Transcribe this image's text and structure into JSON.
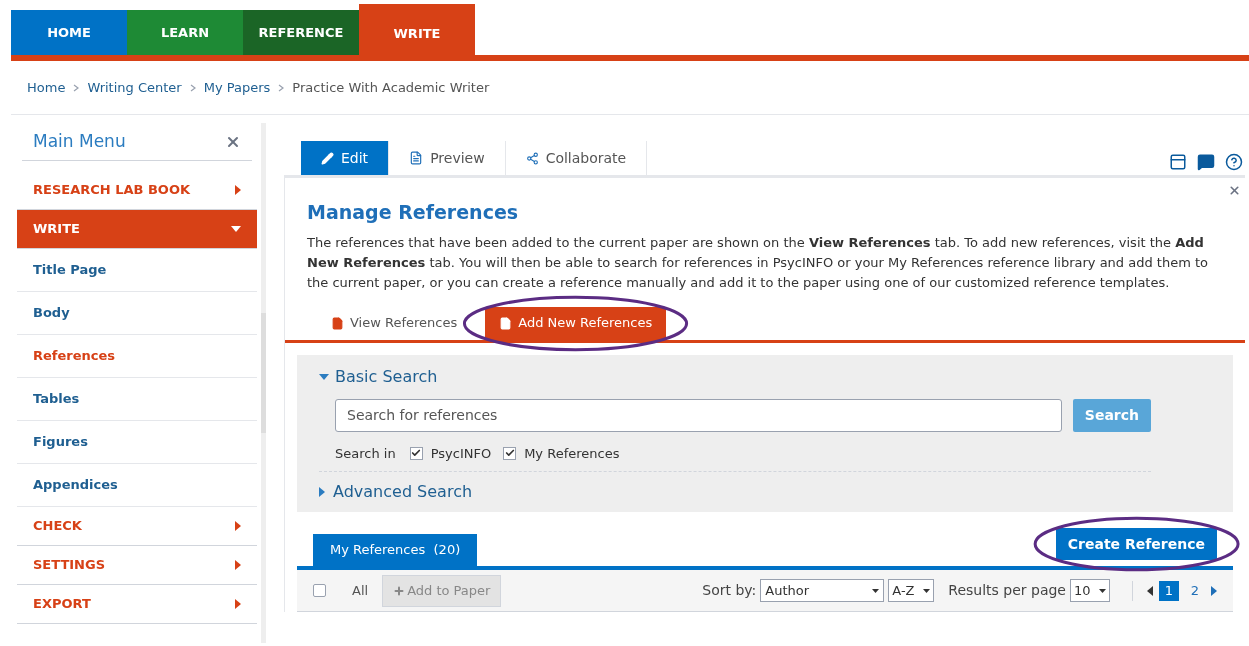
{
  "nav": {
    "tabs": [
      {
        "label": "HOME",
        "color": "#0072c6",
        "selected": false
      },
      {
        "label": "LEARN",
        "color": "#1e8a35",
        "selected": false
      },
      {
        "label": "REFERENCE",
        "color": "#1b6526",
        "selected": false
      },
      {
        "label": "WRITE",
        "color": "#d74116",
        "selected": true
      }
    ]
  },
  "breadcrumb": [
    {
      "label": "Home",
      "kind": "link"
    },
    {
      "label": "Writing Center",
      "kind": "link"
    },
    {
      "label": "My Papers",
      "kind": "link"
    },
    {
      "label": "Practice With Academic Writer",
      "kind": "current"
    }
  ],
  "sidebar": {
    "title": "Main Menu",
    "items": [
      {
        "label": "RESEARCH LAB BOOK",
        "kind": "section",
        "selected": false,
        "expanded": false
      },
      {
        "label": "WRITE",
        "kind": "section",
        "selected": true,
        "expanded": true
      },
      {
        "label": "Title Page",
        "kind": "sub",
        "selected": false
      },
      {
        "label": "Body",
        "kind": "sub",
        "selected": false
      },
      {
        "label": "References",
        "kind": "sub",
        "selected": true
      },
      {
        "label": "Tables",
        "kind": "sub",
        "selected": false
      },
      {
        "label": "Figures",
        "kind": "sub",
        "selected": false
      },
      {
        "label": "Appendices",
        "kind": "sub",
        "selected": false
      },
      {
        "label": "CHECK",
        "kind": "section",
        "selected": false,
        "expanded": false
      },
      {
        "label": "SETTINGS",
        "kind": "section",
        "selected": false,
        "expanded": false
      },
      {
        "label": "EXPORT",
        "kind": "section",
        "selected": false,
        "expanded": false
      }
    ]
  },
  "editor_tabs": [
    {
      "label": "Edit",
      "kind": "edit",
      "selected": true
    },
    {
      "label": "Preview",
      "kind": "preview",
      "selected": false
    },
    {
      "label": "Collaborate",
      "kind": "collaborate",
      "selected": false
    }
  ],
  "panel": {
    "title": "Manage References",
    "description": "The references that have been added to the current paper are shown on the **View References** tab. To add new references, visit the **Add New References** tab. You will then be able to search for references in PsycINFO or your My References reference library and add them to the current paper, or you can create a reference manually and add it to the paper using one of our customized reference templates.",
    "ref_tabs": [
      {
        "label": "View References",
        "selected": false,
        "highlighted": false
      },
      {
        "label": "Add New References",
        "selected": true,
        "highlighted": true
      }
    ],
    "basic_search": {
      "label": "Basic Search",
      "expanded": true,
      "placeholder": "Search for references",
      "button": "Search",
      "search_in_label": "Search in",
      "sources": [
        {
          "label": "PsycINFO",
          "checked": true
        },
        {
          "label": "My References",
          "checked": true
        }
      ]
    },
    "advanced_search": {
      "label": "Advanced Search",
      "expanded": false
    },
    "list_tab": "My References  (20)",
    "create_button": {
      "label": "Create Reference",
      "highlighted": true
    },
    "toolbar": {
      "select_all_checked": false,
      "all_label": "All",
      "add_button": {
        "label": "Add to Paper",
        "disabled": true
      },
      "sort_label": "Sort by:",
      "sort_value": "Author",
      "order_value": "A-Z",
      "results_label": "Results per page",
      "per_page": "10",
      "pages": [
        {
          "label": "1",
          "selected": true
        },
        {
          "label": "2",
          "selected": false
        }
      ]
    }
  }
}
